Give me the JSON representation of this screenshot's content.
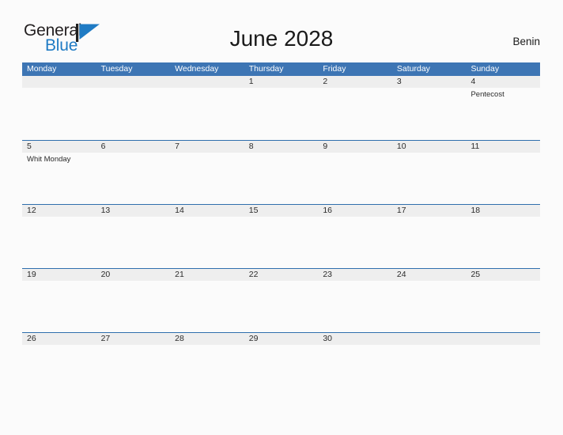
{
  "brand": {
    "name_part1": "General",
    "name_part2": "Blue",
    "flag_icon": "blue-flag-triangle",
    "color_dark": "#231f20",
    "color_blue": "#1f7bc4"
  },
  "header": {
    "title": "June 2028",
    "country": "Benin"
  },
  "theme": {
    "header_blue": "#3d75b4",
    "row_border_blue": "#2f6fad",
    "date_band_gray": "#eeeeee",
    "page_background": "#fbfbfb",
    "text": "#2b2b2b"
  },
  "calendar": {
    "month": "June",
    "year": "2028",
    "weekday_headers": [
      "Monday",
      "Tuesday",
      "Wednesday",
      "Thursday",
      "Friday",
      "Saturday",
      "Sunday"
    ],
    "weeks": [
      [
        {
          "day": "",
          "events": []
        },
        {
          "day": "",
          "events": []
        },
        {
          "day": "",
          "events": []
        },
        {
          "day": "1",
          "events": []
        },
        {
          "day": "2",
          "events": []
        },
        {
          "day": "3",
          "events": []
        },
        {
          "day": "4",
          "events": [
            "Pentecost"
          ]
        }
      ],
      [
        {
          "day": "5",
          "events": [
            "Whit Monday"
          ]
        },
        {
          "day": "6",
          "events": []
        },
        {
          "day": "7",
          "events": []
        },
        {
          "day": "8",
          "events": []
        },
        {
          "day": "9",
          "events": []
        },
        {
          "day": "10",
          "events": []
        },
        {
          "day": "11",
          "events": []
        }
      ],
      [
        {
          "day": "12",
          "events": []
        },
        {
          "day": "13",
          "events": []
        },
        {
          "day": "14",
          "events": []
        },
        {
          "day": "15",
          "events": []
        },
        {
          "day": "16",
          "events": []
        },
        {
          "day": "17",
          "events": []
        },
        {
          "day": "18",
          "events": []
        }
      ],
      [
        {
          "day": "19",
          "events": []
        },
        {
          "day": "20",
          "events": []
        },
        {
          "day": "21",
          "events": []
        },
        {
          "day": "22",
          "events": []
        },
        {
          "day": "23",
          "events": []
        },
        {
          "day": "24",
          "events": []
        },
        {
          "day": "25",
          "events": []
        }
      ],
      [
        {
          "day": "26",
          "events": []
        },
        {
          "day": "27",
          "events": []
        },
        {
          "day": "28",
          "events": []
        },
        {
          "day": "29",
          "events": []
        },
        {
          "day": "30",
          "events": []
        },
        {
          "day": "",
          "events": []
        },
        {
          "day": "",
          "events": []
        }
      ]
    ]
  }
}
